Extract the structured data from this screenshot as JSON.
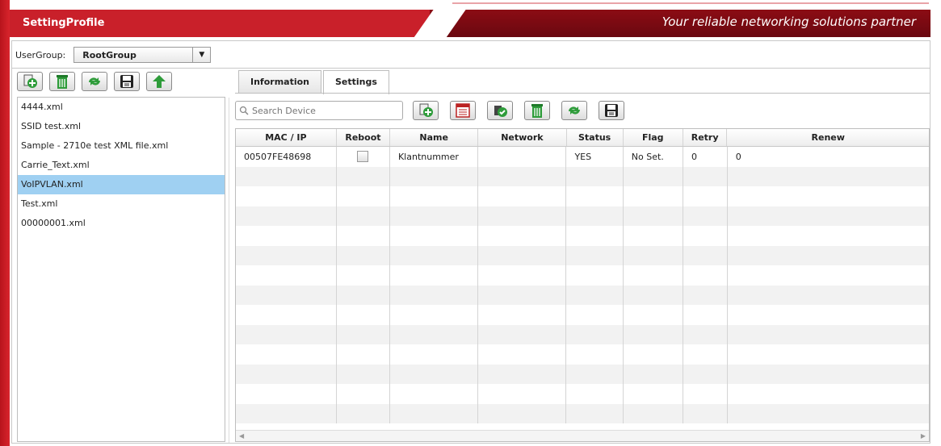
{
  "app": {
    "title": "SettingProfile",
    "tagline": "Your reliable networking solutions partner"
  },
  "usergroup": {
    "label": "UserGroup:",
    "selected": "RootGroup"
  },
  "left_toolbar": {
    "icons": [
      "add-icon",
      "trash-icon",
      "refresh-icon",
      "save-icon",
      "upload-icon"
    ]
  },
  "files": [
    "4444.xml",
    "SSID test.xml",
    "Sample - 2710e test XML file.xml",
    "Carrie_Text.xml",
    "VoIPVLAN.xml",
    "Test.xml",
    "00000001.xml"
  ],
  "selected_file": "VoIPVLAN.xml",
  "tabs": [
    {
      "label": "Information",
      "active": false
    },
    {
      "label": "Settings",
      "active": true
    }
  ],
  "search": {
    "placeholder": "Search Device",
    "value": ""
  },
  "right_toolbar": {
    "icons": [
      "add-device-icon",
      "list-icon",
      "apply-icon",
      "trash-icon",
      "refresh-icon",
      "save-icon"
    ]
  },
  "table": {
    "columns": [
      "MAC / IP",
      "Reboot",
      "Name",
      "Network",
      "Status",
      "Flag",
      "Retry",
      "Renew"
    ],
    "rows": [
      {
        "mac": "00507FE48698",
        "reboot": false,
        "name": "Klantnummer",
        "network": "",
        "status": "YES",
        "flag": "No Set.",
        "retry": "0",
        "renew": "0"
      }
    ]
  },
  "colors": {
    "header_red": "#c9202a",
    "header_dark": "#8c0c14",
    "selection": "#9fd0f2",
    "accent_green": "#2e9c3a"
  }
}
